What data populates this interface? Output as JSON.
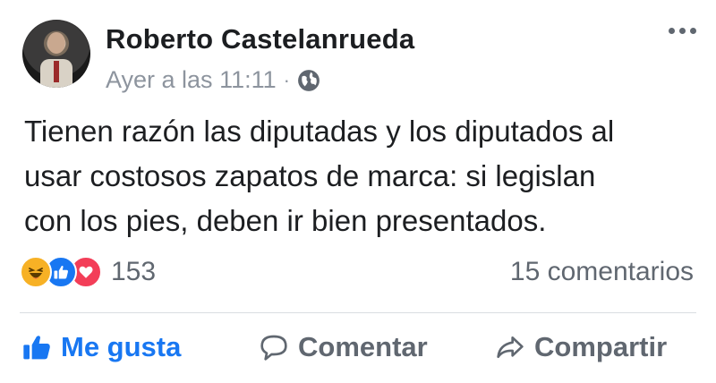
{
  "post": {
    "author": "Roberto Castelanrueda",
    "timestamp": "Ayer a las 11:11",
    "separator": "·",
    "privacy_icon": "globe-icon",
    "text": "Tienen razón las diputadas y los diputados al\nusar costosos zapatos de marca: si legislan\ncon los pies, deben ir bien presentados.",
    "reactions": {
      "types": [
        "haha",
        "like",
        "love"
      ],
      "count": "153"
    },
    "comments_label": "15 comentarios"
  },
  "actions": {
    "like_label": "Me gusta",
    "comment_label": "Comentar",
    "share_label": "Compartir"
  },
  "colors": {
    "accent": "#1877f2",
    "muted_text": "#606770",
    "meta_text": "#8d949e",
    "haha": "#f7b125",
    "love": "#f33e58"
  }
}
